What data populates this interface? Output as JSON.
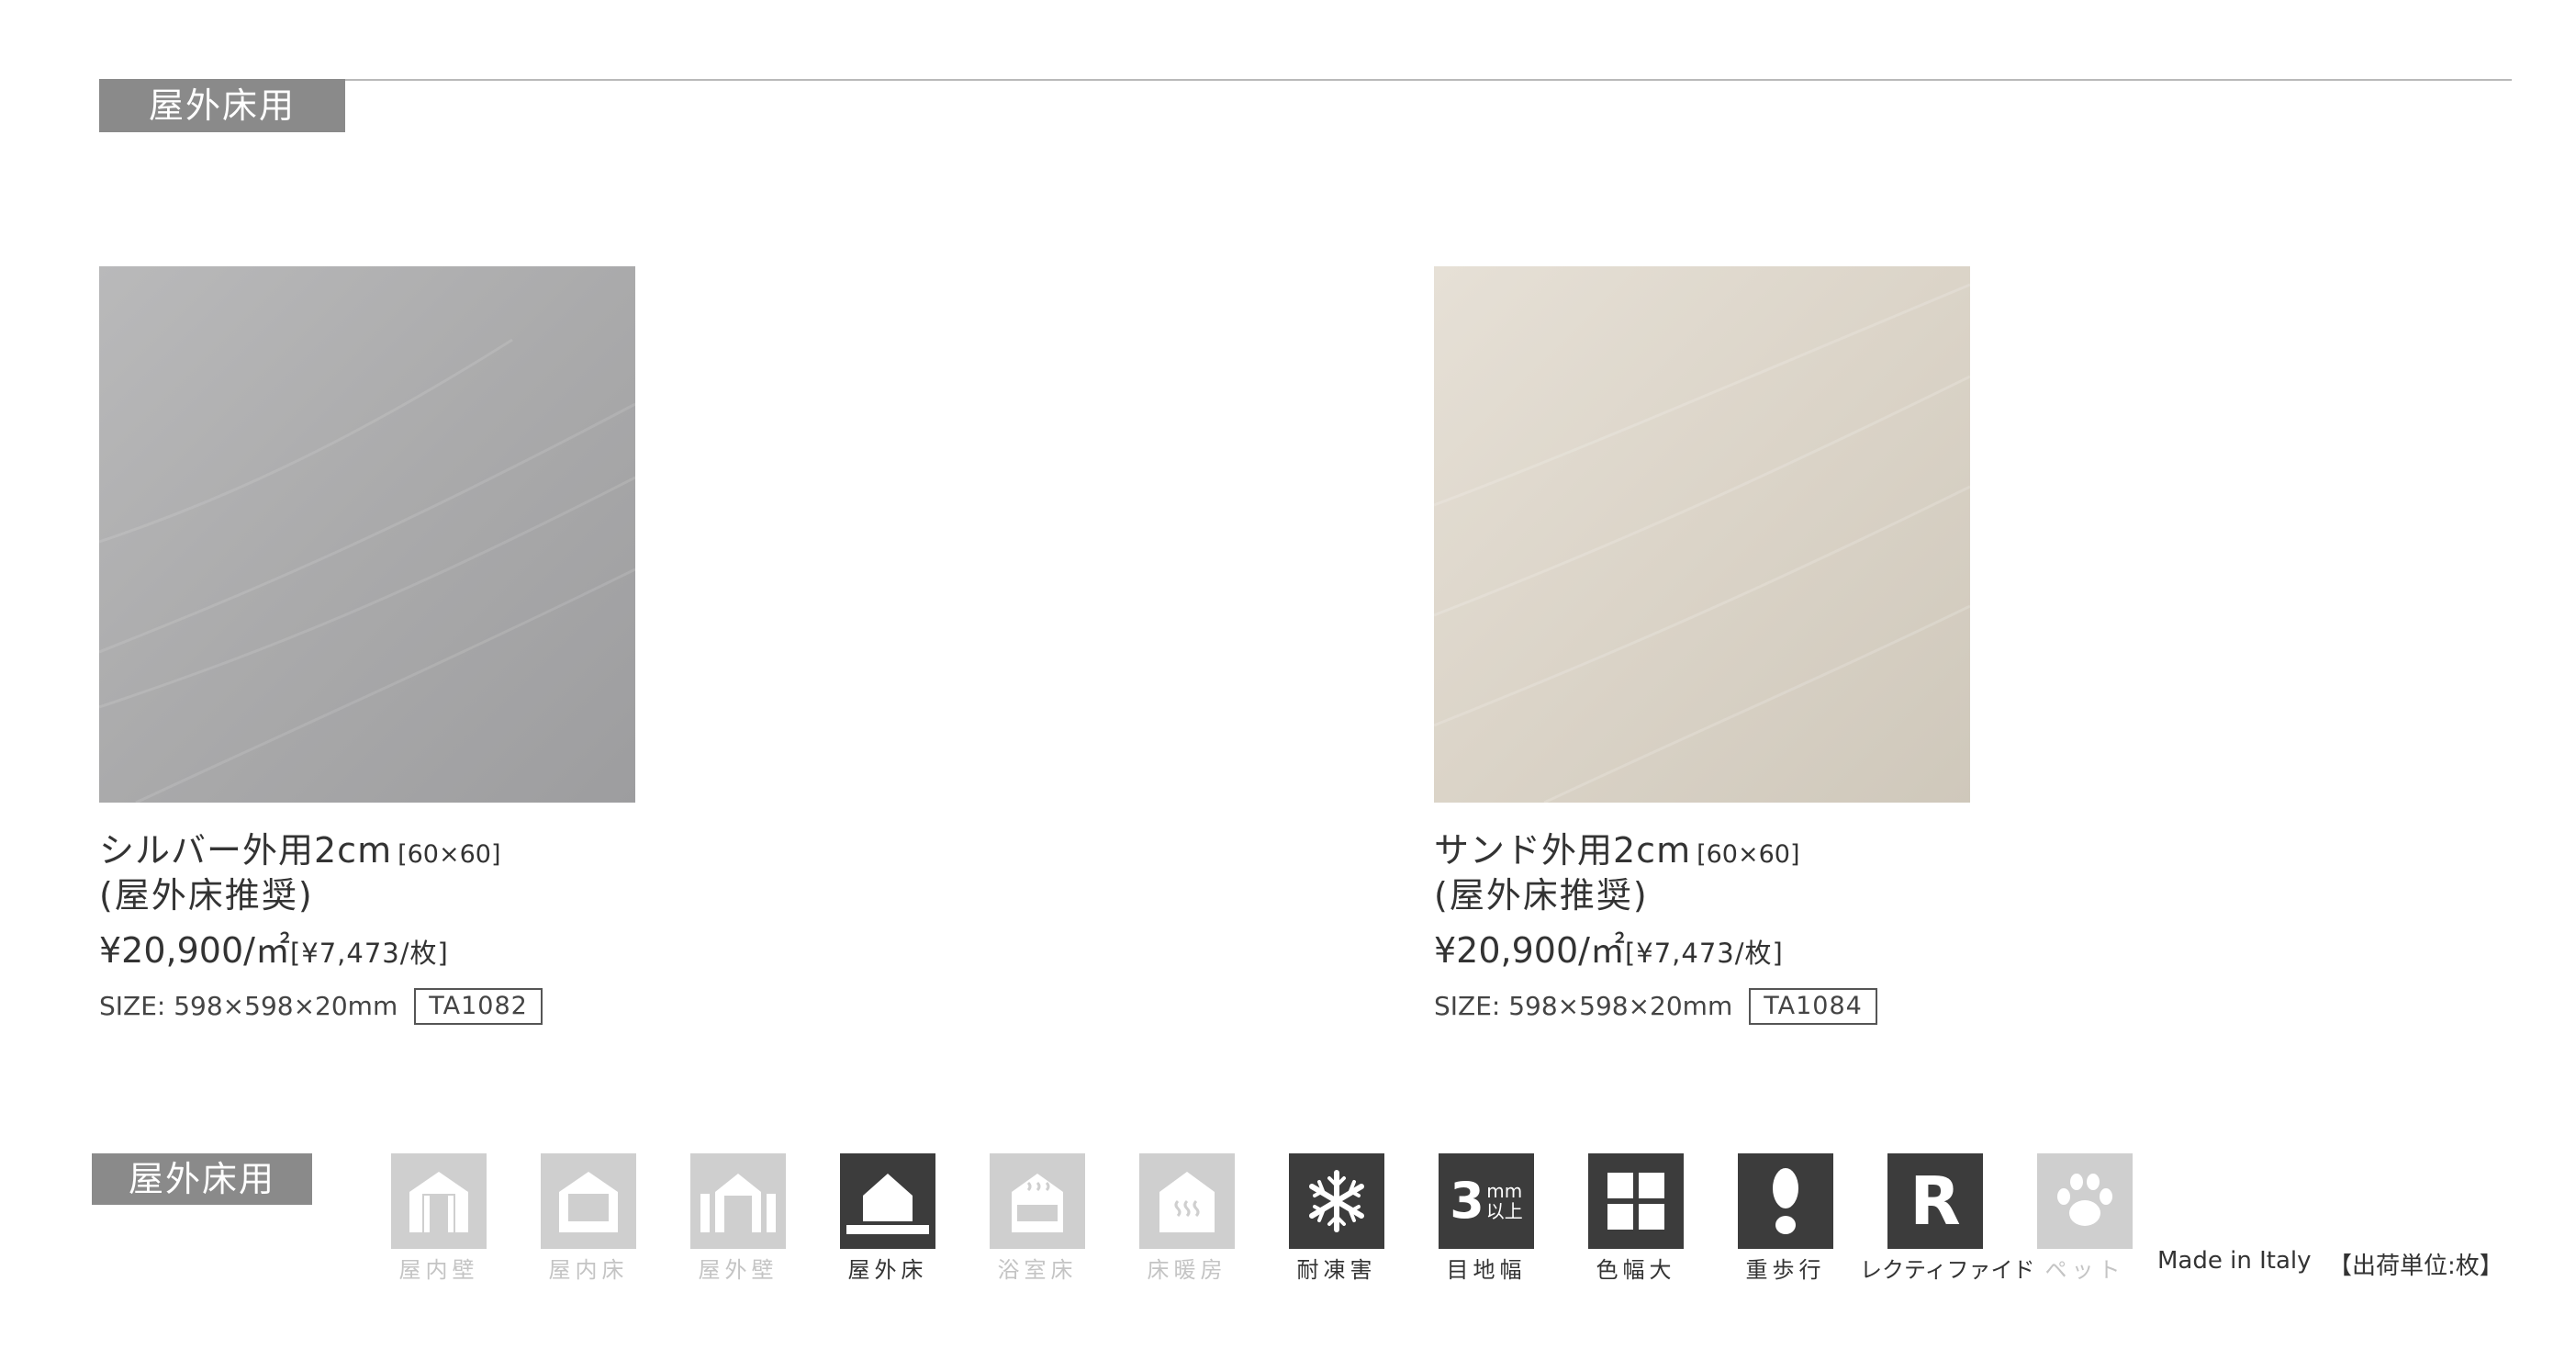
{
  "section": {
    "title": "屋外床用"
  },
  "products": [
    {
      "name": "シルバー外用2cm",
      "size_tag": "[60×60]",
      "recommendation": "(屋外床推奨)",
      "price": "¥20,900/㎡",
      "unit_price": "[¥7,473/枚]",
      "size": "SIZE: 598×598×20mm",
      "code": "TA1082",
      "swatch_color": "#aaaaab",
      "swatch_highlight": "#b9b9ba",
      "swatch_shadow": "#9d9d9f"
    },
    {
      "name": "サンド外用2cm",
      "size_tag": "[60×60]",
      "recommendation": "(屋外床推奨)",
      "price": "¥20,900/㎡",
      "unit_price": "[¥7,473/枚]",
      "size": "SIZE: 598×598×20mm",
      "code": "TA1084",
      "swatch_color": "#dbd4c8",
      "swatch_highlight": "#e6e0d6",
      "swatch_shadow": "#cfc8bb"
    }
  ],
  "usage": {
    "tag": "屋外床用",
    "icons": [
      {
        "label": "屋内壁",
        "icon": "indoor-wall-icon",
        "active": false
      },
      {
        "label": "屋内床",
        "icon": "indoor-floor-icon",
        "active": false
      },
      {
        "label": "屋外壁",
        "icon": "outdoor-wall-icon",
        "active": false
      },
      {
        "label": "屋外床",
        "icon": "outdoor-floor-icon",
        "active": true
      },
      {
        "label": "浴室床",
        "icon": "bathroom-floor-icon",
        "active": false
      },
      {
        "label": "床暖房",
        "icon": "floor-heating-icon",
        "active": false
      },
      {
        "label": "耐凍害",
        "icon": "snowflake-icon",
        "active": true
      },
      {
        "label": "目地幅",
        "icon": "joint-width-icon",
        "active": true,
        "badge_number": "3",
        "badge_unit": "mm",
        "badge_suffix": "以上"
      },
      {
        "label": "色幅大",
        "icon": "color-variation-icon",
        "active": true
      },
      {
        "label": "重歩行",
        "icon": "heavy-traffic-icon",
        "active": true
      },
      {
        "label": "レクティファイド",
        "icon": "rectified-icon",
        "active": true,
        "badge_letter": "R"
      },
      {
        "label": "ペット",
        "icon": "pet-icon",
        "active": false
      }
    ],
    "made_in": "Made in Italy",
    "unit_note": "【出荷単位:枚】"
  },
  "colors": {
    "tag_bg": "#8a8a8a",
    "icon_active": "#3c3c3c",
    "icon_inactive": "#cfcfcf"
  }
}
